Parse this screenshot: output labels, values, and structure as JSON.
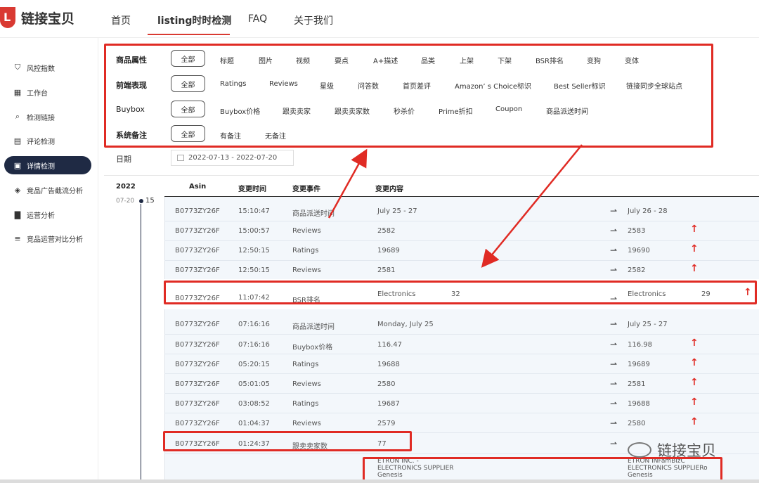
{
  "brand": {
    "logo_letter": "L",
    "name": "链接宝贝"
  },
  "topnav": {
    "items": [
      {
        "label": "首页",
        "active": false
      },
      {
        "label": "listing时时检测",
        "active": true
      },
      {
        "label": "FAQ",
        "active": false
      },
      {
        "label": "关于我们",
        "active": false
      }
    ]
  },
  "sidebar": {
    "items": [
      {
        "label": "风控指数",
        "icon": "shield-icon",
        "active": false
      },
      {
        "label": "工作台",
        "icon": "grid-icon",
        "active": false
      },
      {
        "label": "检测链接",
        "icon": "magnifier-icon",
        "active": false
      },
      {
        "label": "评论检测",
        "icon": "comment-doc-icon",
        "active": false
      },
      {
        "label": "详情检测",
        "icon": "detail-search-icon",
        "active": true
      },
      {
        "label": "竞品广告截流分析",
        "icon": "layers-icon",
        "active": false
      },
      {
        "label": "运营分析",
        "icon": "bar-chart-icon",
        "active": false
      },
      {
        "label": "竞品运营对比分析",
        "icon": "compare-icon",
        "active": false
      }
    ]
  },
  "filters": {
    "all_label": "全部",
    "rows": [
      {
        "label": "商品属性",
        "chips": [
          "标题",
          "图片",
          "视频",
          "要点",
          "A+描述",
          "品类",
          "上架",
          "下架",
          "BSR排名",
          "变狗",
          "变体"
        ]
      },
      {
        "label": "前端表现",
        "chips": [
          "Ratings",
          "Reviews",
          "星级",
          "问答数",
          "首页差评",
          "Amazon’ s Choice标识",
          "Best Seller标识",
          "链接同步全球站点"
        ]
      },
      {
        "label": "Buybox",
        "chips": [
          "Buybox价格",
          "跟卖卖家",
          "跟卖卖家数",
          "秒杀价",
          "Prime折扣",
          "Coupon",
          "商品派送时间"
        ]
      },
      {
        "label": "系统备注",
        "chips": [
          "有备注",
          "无备注"
        ]
      }
    ]
  },
  "date": {
    "label": "日期",
    "range": "2022-07-13  - 2022-07-20"
  },
  "timeline": {
    "year": "2022",
    "date": "07-20",
    "count": "15"
  },
  "table": {
    "headers": {
      "asin": "Asin",
      "time": "变更时间",
      "event": "变更事件",
      "content": "变更内容"
    },
    "rows": [
      {
        "asin": "B0773ZY26F",
        "time": "15:10:47",
        "event": "商品派送时间",
        "old": "July 25 - 27",
        "old2": "",
        "new": "July 26 - 28",
        "new2": "",
        "up": false
      },
      {
        "asin": "B0773ZY26F",
        "time": "15:00:57",
        "event": "Reviews",
        "old": "2582",
        "old2": "",
        "new": "2583",
        "new2": "",
        "up": true
      },
      {
        "asin": "B0773ZY26F",
        "time": "12:50:15",
        "event": "Ratings",
        "old": "19689",
        "old2": "",
        "new": "19690",
        "new2": "",
        "up": true
      },
      {
        "asin": "B0773ZY26F",
        "time": "12:50:15",
        "event": "Reviews",
        "old": "2581",
        "old2": "",
        "new": "2582",
        "new2": "",
        "up": true
      },
      {
        "asin": "B0773ZY26F",
        "time": "11:07:42",
        "event": "BSR排名",
        "old": "Electronics",
        "old2": "32",
        "new": "Electronics",
        "new2": "29",
        "up": true
      },
      {
        "asin": "B0773ZY26F",
        "time": "07:16:16",
        "event": "商品派送时间",
        "old": "Monday, July 25",
        "old2": "",
        "new": "July 25 - 27",
        "new2": "",
        "up": false
      },
      {
        "asin": "B0773ZY26F",
        "time": "07:16:16",
        "event": "Buybox价格",
        "old": "116.47",
        "old2": "",
        "new": "116.98",
        "new2": "",
        "up": true
      },
      {
        "asin": "B0773ZY26F",
        "time": "05:20:15",
        "event": "Ratings",
        "old": "19688",
        "old2": "",
        "new": "19689",
        "new2": "",
        "up": true
      },
      {
        "asin": "B0773ZY26F",
        "time": "05:01:05",
        "event": "Reviews",
        "old": "2580",
        "old2": "",
        "new": "2581",
        "new2": "",
        "up": true
      },
      {
        "asin": "B0773ZY26F",
        "time": "03:08:52",
        "event": "Ratings",
        "old": "19687",
        "old2": "",
        "new": "19688",
        "new2": "",
        "up": true
      },
      {
        "asin": "B0773ZY26F",
        "time": "01:04:37",
        "event": "Reviews",
        "old": "2579",
        "old2": "",
        "new": "2580",
        "new2": "",
        "up": true
      },
      {
        "asin": "B0773ZY26F",
        "time": "01:24:37",
        "event": "跟卖卖家数",
        "old": "77",
        "old2": "",
        "new": "",
        "new2": "",
        "up": false
      }
    ],
    "seller_old": "ETRON INC. - ELECTRONICS SUPPLIER Genesis",
    "seller_new": "ETRON INFamBizC ELECTRONICS SUPPLIERo Genesis"
  },
  "watermark": {
    "text": "链接宝贝"
  },
  "colors": {
    "accent": "#e02b24",
    "nav_dark": "#1f2a44",
    "panel": "#f3f7fb"
  }
}
